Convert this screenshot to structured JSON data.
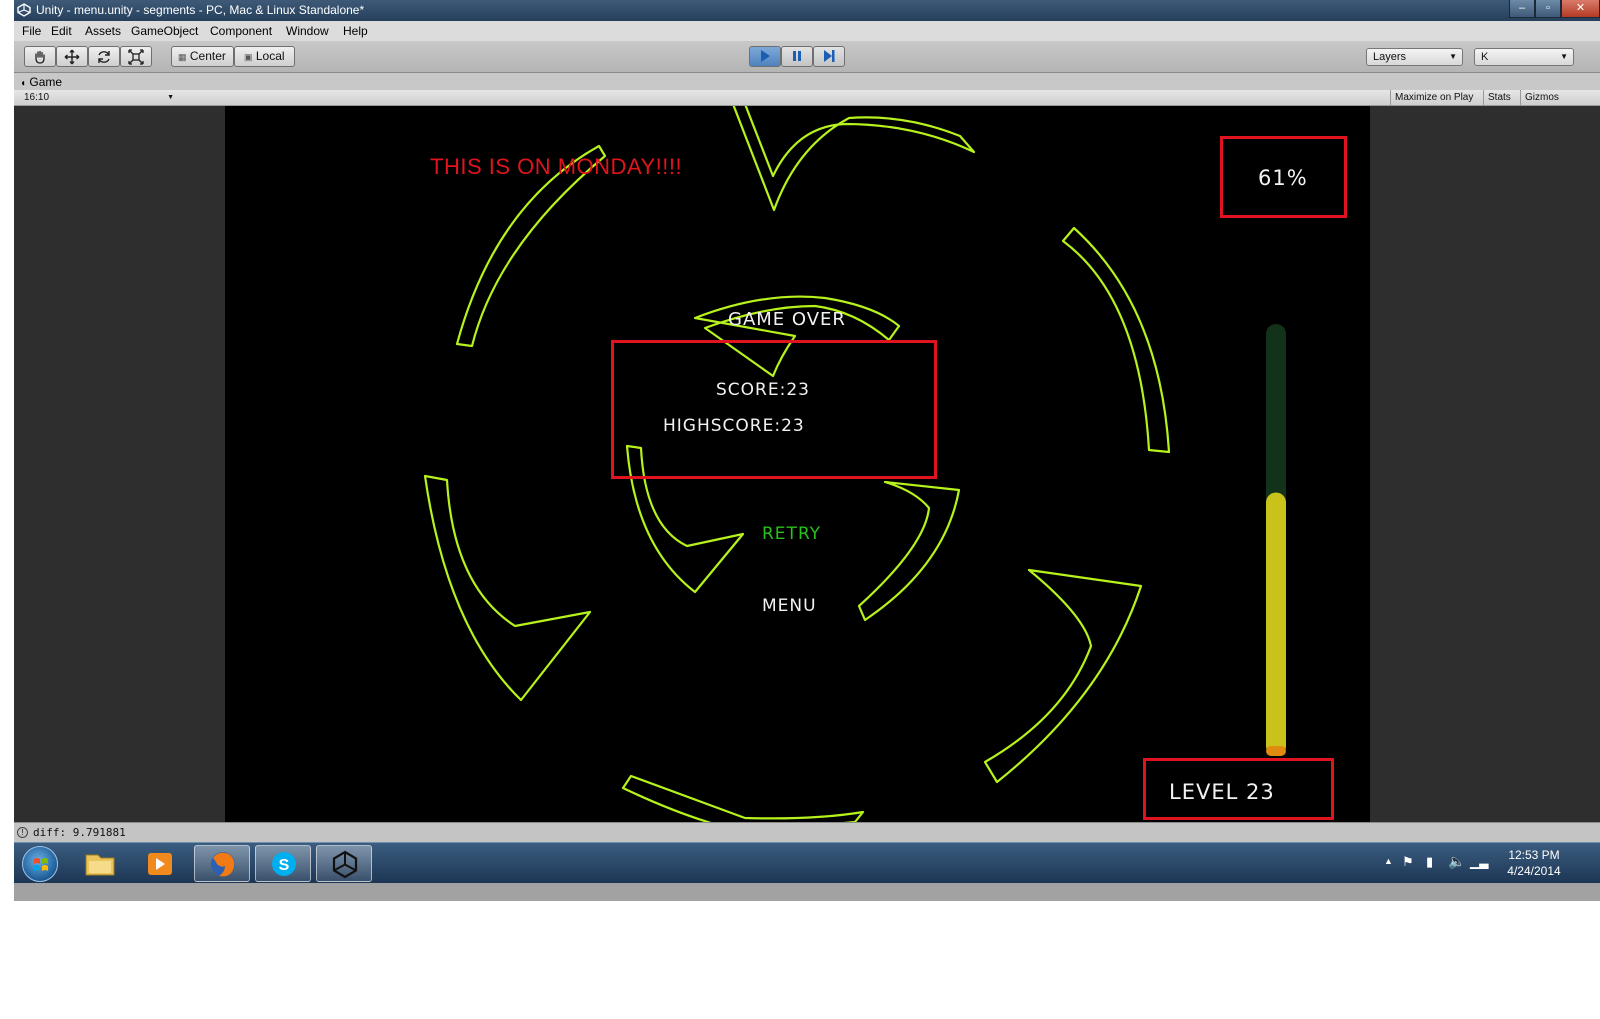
{
  "window": {
    "title": "Unity - menu.unity - segments - PC, Mac & Linux Standalone*"
  },
  "menu": {
    "items": [
      "File",
      "Edit",
      "Assets",
      "GameObject",
      "Component",
      "Window",
      "Help"
    ]
  },
  "toolbar": {
    "tools": [
      "hand-icon",
      "move-icon",
      "rotate-icon",
      "scale-icon"
    ],
    "pivot_label": "Center",
    "space_label": "Local",
    "play_buttons": [
      "play-icon",
      "pause-icon",
      "step-icon"
    ],
    "layers_label": "Layers",
    "layout_label": "K"
  },
  "game_panel": {
    "tab_label": "Game",
    "aspect_label": "16:10",
    "maximize_label": "Maximize on Play",
    "stats_label": "Stats",
    "gizmos_label": "Gizmos"
  },
  "game": {
    "annotation": "THIS IS ON MONDAY!!!!",
    "percent": "61%",
    "title": "GAME OVER",
    "score": "SCORE:23",
    "highscore": "HIGHSCORE:23",
    "retry": "RETRY",
    "menu": "MENU",
    "level": "LEVEL  23",
    "progress_fraction": 0.61,
    "colors": {
      "segment": "#b6f21c",
      "retry": "#26c21a",
      "highlight_box": "#e0141e",
      "bar_fill": "#c8c21a",
      "bar_empty": "#12321a"
    }
  },
  "status": {
    "message": "diff: 9.791881"
  },
  "taskbar": {
    "apps": [
      "windows-explorer-icon",
      "media-player-icon",
      "firefox-icon",
      "skype-icon",
      "unity-icon"
    ],
    "time": "12:53 PM",
    "date": "4/24/2014"
  }
}
